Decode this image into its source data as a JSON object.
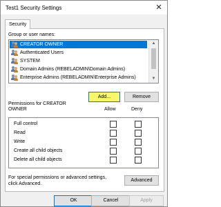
{
  "window": {
    "title": "Test1 Security Settings"
  },
  "tabs": [
    {
      "label": "Security"
    }
  ],
  "groups": {
    "label": "Group or user names:",
    "items": [
      {
        "name": "CREATOR OWNER",
        "selected": true
      },
      {
        "name": "Authenticated Users",
        "selected": false
      },
      {
        "name": "SYSTEM",
        "selected": false
      },
      {
        "name": "Domain Admins (REBELADMIN\\Domain Admins)",
        "selected": false
      },
      {
        "name": "Enterprise Admins (REBELADMIN\\Enterprise Admins)",
        "selected": false
      }
    ]
  },
  "buttons": {
    "add": "Add...",
    "remove": "Remove",
    "advanced": "Advanced",
    "ok": "OK",
    "cancel": "Cancel",
    "apply": "Apply"
  },
  "permissions": {
    "title_line1": "Permissions for CREATOR",
    "title_line2": "OWNER",
    "allow_label": "Allow",
    "deny_label": "Deny",
    "items": [
      {
        "name": "Full control",
        "allow": false,
        "deny": false
      },
      {
        "name": "Read",
        "allow": false,
        "deny": false
      },
      {
        "name": "Write",
        "allow": false,
        "deny": false
      },
      {
        "name": "Create all child objects",
        "allow": false,
        "deny": false
      },
      {
        "name": "Delete all child objects",
        "allow": false,
        "deny": false
      }
    ]
  },
  "advanced_text": {
    "line1": "For special permissions or advanced settings,",
    "line2": "click Advanced."
  },
  "colors": {
    "selection": "#0078d7",
    "add_highlight": "#f7f76a"
  },
  "icons": {
    "close": "close-icon",
    "user": "user-group-icon",
    "scroll_up": "scroll-up-icon",
    "scroll_down": "scroll-down-icon"
  }
}
